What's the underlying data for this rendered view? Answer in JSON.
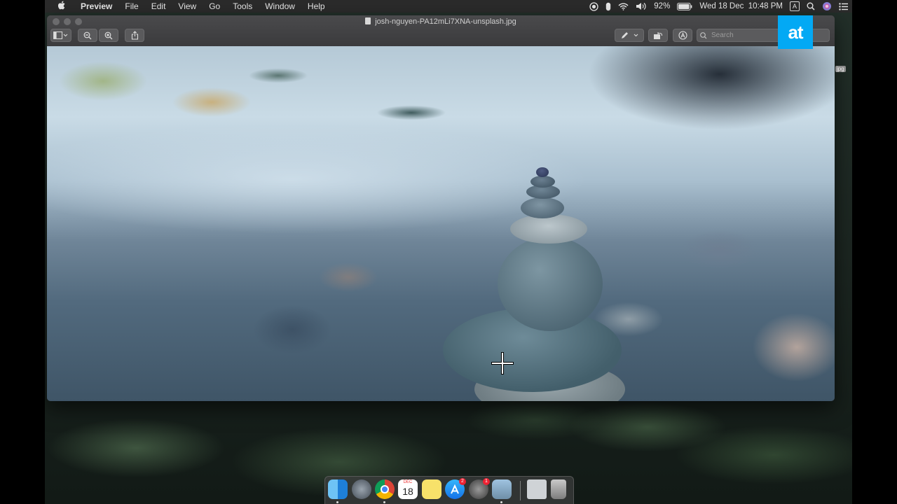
{
  "menubar": {
    "app_name": "Preview",
    "menus": [
      "File",
      "Edit",
      "View",
      "Go",
      "Tools",
      "Window",
      "Help"
    ],
    "battery": "92%",
    "clock": "Wed 18 Dec  10:48 PM",
    "input_letter": "A"
  },
  "window": {
    "title": "josh-nguyen-PA12mLi7XNA-unsplash.jpg",
    "search_placeholder": "Search"
  },
  "desktop": {
    "file_label": "jpg"
  },
  "dock": {
    "calendar_month": "DEC",
    "calendar_day": "18",
    "appstore_badge": "2",
    "prefs_badge": "1"
  },
  "logo": {
    "text": "at",
    "color": "#03a9f4"
  }
}
